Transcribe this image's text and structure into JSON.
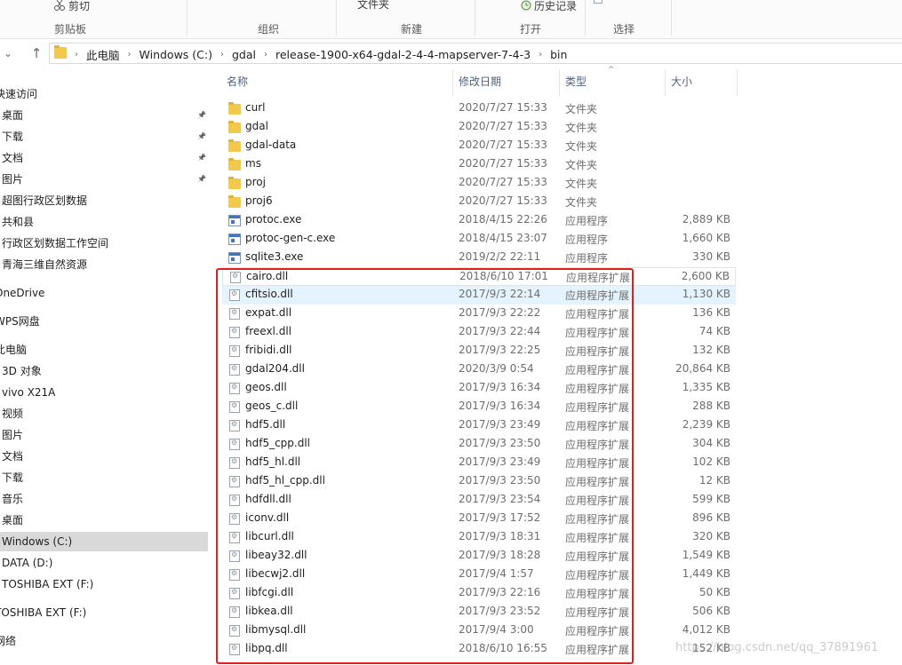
{
  "ribbon": {
    "cut_label": "剪切",
    "folder_label": "文件夹",
    "history_label": "历史记录",
    "groups": [
      "剪贴板",
      "组织",
      "新建",
      "打开",
      "选择"
    ]
  },
  "address": {
    "crumbs": [
      "此电脑",
      "Windows (C:)",
      "gdal",
      "release-1900-x64-gdal-2-4-4-mapserver-7-4-3",
      "bin"
    ]
  },
  "sidebar": {
    "items": [
      {
        "label": "快速访问"
      },
      {
        "label": "桌面"
      },
      {
        "label": "下载"
      },
      {
        "label": "文档"
      },
      {
        "label": "图片"
      },
      {
        "label": "超图行政区划数据"
      },
      {
        "label": "共和县"
      },
      {
        "label": "行政区划数据工作空间"
      },
      {
        "label": "青海三维自然资源"
      },
      {
        "label": "OneDrive"
      },
      {
        "label": "WPS网盘"
      },
      {
        "label": "此电脑"
      },
      {
        "label": "3D 对象"
      },
      {
        "label": "vivo X21A"
      },
      {
        "label": "视频"
      },
      {
        "label": "图片"
      },
      {
        "label": "文档"
      },
      {
        "label": "下载"
      },
      {
        "label": "音乐"
      },
      {
        "label": "桌面"
      },
      {
        "label": "Windows (C:)"
      },
      {
        "label": "DATA (D:)"
      },
      {
        "label": "TOSHIBA EXT (F:)"
      },
      {
        "label": "TOSHIBA EXT (F:)"
      },
      {
        "label": "网络"
      }
    ]
  },
  "columns": {
    "name": "名称",
    "date": "修改日期",
    "type": "类型",
    "size": "大小"
  },
  "files": [
    {
      "name": "curl",
      "date": "2020/7/27 15:33",
      "type": "文件夹",
      "size": "",
      "icon": "folder"
    },
    {
      "name": "gdal",
      "date": "2020/7/27 15:33",
      "type": "文件夹",
      "size": "",
      "icon": "folder"
    },
    {
      "name": "gdal-data",
      "date": "2020/7/27 15:33",
      "type": "文件夹",
      "size": "",
      "icon": "folder"
    },
    {
      "name": "ms",
      "date": "2020/7/27 15:33",
      "type": "文件夹",
      "size": "",
      "icon": "folder"
    },
    {
      "name": "proj",
      "date": "2020/7/27 15:33",
      "type": "文件夹",
      "size": "",
      "icon": "folder"
    },
    {
      "name": "proj6",
      "date": "2020/7/27 15:33",
      "type": "文件夹",
      "size": "",
      "icon": "folder"
    },
    {
      "name": "protoc.exe",
      "date": "2018/4/15 22:26",
      "type": "应用程序",
      "size": "2,889 KB",
      "icon": "exe"
    },
    {
      "name": "protoc-gen-c.exe",
      "date": "2018/4/15 23:07",
      "type": "应用程序",
      "size": "1,660 KB",
      "icon": "exe"
    },
    {
      "name": "sqlite3.exe",
      "date": "2019/2/2 22:11",
      "type": "应用程序",
      "size": "330 KB",
      "icon": "exe"
    },
    {
      "name": "cairo.dll",
      "date": "2018/6/10 17:01",
      "type": "应用程序扩展",
      "size": "2,600 KB",
      "icon": "dll"
    },
    {
      "name": "cfitsio.dll",
      "date": "2017/9/3 22:14",
      "type": "应用程序扩展",
      "size": "1,130 KB",
      "icon": "dll"
    },
    {
      "name": "expat.dll",
      "date": "2017/9/3 22:22",
      "type": "应用程序扩展",
      "size": "136 KB",
      "icon": "dll"
    },
    {
      "name": "freexl.dll",
      "date": "2017/9/3 22:44",
      "type": "应用程序扩展",
      "size": "74 KB",
      "icon": "dll"
    },
    {
      "name": "fribidi.dll",
      "date": "2017/9/3 22:25",
      "type": "应用程序扩展",
      "size": "132 KB",
      "icon": "dll"
    },
    {
      "name": "gdal204.dll",
      "date": "2020/3/9 0:54",
      "type": "应用程序扩展",
      "size": "20,864 KB",
      "icon": "dll"
    },
    {
      "name": "geos.dll",
      "date": "2017/9/3 16:34",
      "type": "应用程序扩展",
      "size": "1,335 KB",
      "icon": "dll"
    },
    {
      "name": "geos_c.dll",
      "date": "2017/9/3 16:34",
      "type": "应用程序扩展",
      "size": "288 KB",
      "icon": "dll"
    },
    {
      "name": "hdf5.dll",
      "date": "2017/9/3 23:49",
      "type": "应用程序扩展",
      "size": "2,239 KB",
      "icon": "dll"
    },
    {
      "name": "hdf5_cpp.dll",
      "date": "2017/9/3 23:50",
      "type": "应用程序扩展",
      "size": "304 KB",
      "icon": "dll"
    },
    {
      "name": "hdf5_hl.dll",
      "date": "2017/9/3 23:49",
      "type": "应用程序扩展",
      "size": "102 KB",
      "icon": "dll"
    },
    {
      "name": "hdf5_hl_cpp.dll",
      "date": "2017/9/3 23:50",
      "type": "应用程序扩展",
      "size": "12 KB",
      "icon": "dll"
    },
    {
      "name": "hdfdll.dll",
      "date": "2017/9/3 23:54",
      "type": "应用程序扩展",
      "size": "599 KB",
      "icon": "dll"
    },
    {
      "name": "iconv.dll",
      "date": "2017/9/3 17:52",
      "type": "应用程序扩展",
      "size": "896 KB",
      "icon": "dll"
    },
    {
      "name": "libcurl.dll",
      "date": "2017/9/3 18:31",
      "type": "应用程序扩展",
      "size": "320 KB",
      "icon": "dll"
    },
    {
      "name": "libeay32.dll",
      "date": "2017/9/3 18:28",
      "type": "应用程序扩展",
      "size": "1,549 KB",
      "icon": "dll"
    },
    {
      "name": "libecwj2.dll",
      "date": "2017/9/4 1:57",
      "type": "应用程序扩展",
      "size": "1,449 KB",
      "icon": "dll"
    },
    {
      "name": "libfcgi.dll",
      "date": "2017/9/3 22:16",
      "type": "应用程序扩展",
      "size": "50 KB",
      "icon": "dll"
    },
    {
      "name": "libkea.dll",
      "date": "2017/9/3 23:52",
      "type": "应用程序扩展",
      "size": "506 KB",
      "icon": "dll"
    },
    {
      "name": "libmysql.dll",
      "date": "2017/9/4 3:00",
      "type": "应用程序扩展",
      "size": "4,012 KB",
      "icon": "dll"
    },
    {
      "name": "libpq.dll",
      "date": "2018/6/10 16:55",
      "type": "应用程序扩展",
      "size": "152 KB",
      "icon": "dll"
    }
  ],
  "watermark": "https://blog.csdn.net/qq_37891961"
}
